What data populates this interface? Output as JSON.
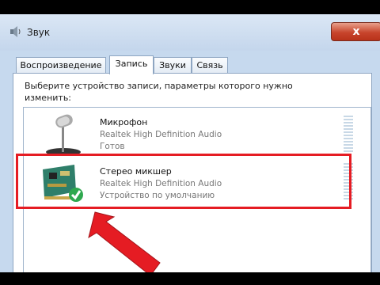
{
  "window": {
    "title": "Звук",
    "close_label": "x"
  },
  "tabs": [
    {
      "label": "Воспроизведение",
      "active": false
    },
    {
      "label": "Запись",
      "active": true
    },
    {
      "label": "Звуки",
      "active": false
    },
    {
      "label": "Связь",
      "active": false
    }
  ],
  "prompt": "Выберите устройство записи, параметры которого нужно изменить:",
  "devices": [
    {
      "name": "Микрофон",
      "driver": "Realtek High Definition Audio",
      "status": "Готов",
      "icon": "microphone-icon"
    },
    {
      "name": "Стерео микшер",
      "driver": "Realtek High Definition Audio",
      "status": "Устройство по умолчанию",
      "icon": "sound-card-icon",
      "default": true
    }
  ],
  "colors": {
    "highlight": "#e51c23",
    "arrow": "#e51c23",
    "check": "#2fa84f"
  }
}
